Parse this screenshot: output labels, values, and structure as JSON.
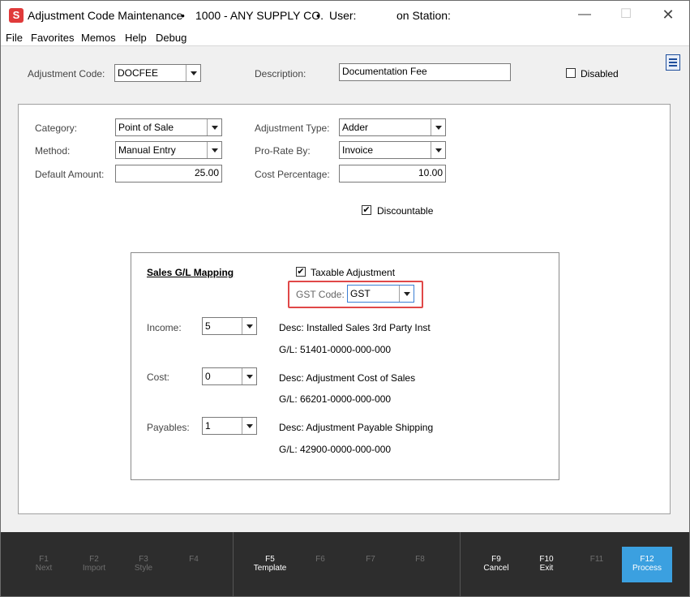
{
  "titlebar": {
    "app_icon": "S",
    "title": "Adjustment Code Maintenance",
    "company": "1000 - ANY SUPPLY CO.",
    "user_label": "User:",
    "station_label": "on Station:",
    "minimize_icon": "minimize-icon",
    "maximize_icon": "maximize-icon",
    "close_icon": "close-icon"
  },
  "menu": [
    "File",
    "Favorites",
    "Memos",
    "Help",
    "Debug"
  ],
  "header": {
    "adjustment_code_label": "Adjustment Code:",
    "adjustment_code_value": "DOCFEE",
    "description_label": "Description:",
    "description_value": "Documentation Fee",
    "disabled_label": "Disabled",
    "disabled_checked": ""
  },
  "details": {
    "category_label": "Category:",
    "category_value": "Point of Sale",
    "method_label": "Method:",
    "method_value": "Manual Entry",
    "default_amount_label": "Default Amount:",
    "default_amount_value": "25.00",
    "adjustment_type_label": "Adjustment Type:",
    "adjustment_type_value": "Adder",
    "prorate_label": "Pro-Rate By:",
    "prorate_value": "Invoice",
    "cost_percentage_label": "Cost Percentage:",
    "cost_percentage_value": "10.00",
    "discountable_label": "Discountable",
    "discountable_checked": "✔"
  },
  "gl_mapping": {
    "title": "Sales G/L Mapping",
    "taxable_label": "Taxable Adjustment",
    "taxable_checked": "✔",
    "gst_label": "GST Code:",
    "gst_value": "GST",
    "income_label": "Income:",
    "income_value": "5",
    "income_desc": "Desc: Installed Sales 3rd Party Inst",
    "income_gl": "G/L: 51401-0000-000-000",
    "cost_label": "Cost:",
    "cost_value": "0",
    "cost_desc": "Desc: Adjustment Cost of Sales",
    "cost_gl": "G/L: 66201-0000-000-000",
    "payables_label": "Payables:",
    "payables_value": "1",
    "payables_desc": "Desc: Adjustment Payable Shipping",
    "payables_gl": "G/L: 42900-0000-000-000"
  },
  "fkeys": [
    {
      "key": "F1",
      "label": "Next"
    },
    {
      "key": "F2",
      "label": "Import"
    },
    {
      "key": "F3",
      "label": "Style"
    },
    {
      "key": "F4",
      "label": ""
    },
    {
      "key": "F5",
      "label": "Template"
    },
    {
      "key": "F6",
      "label": ""
    },
    {
      "key": "F7",
      "label": ""
    },
    {
      "key": "F8",
      "label": ""
    },
    {
      "key": "F9",
      "label": "Cancel"
    },
    {
      "key": "F10",
      "label": "Exit"
    },
    {
      "key": "F11",
      "label": ""
    },
    {
      "key": "F12",
      "label": "Process"
    }
  ],
  "colors": {
    "process_button": "#3ba0e0",
    "highlight_box": "#e04848",
    "fkey_bar": "#2d2d2d"
  }
}
